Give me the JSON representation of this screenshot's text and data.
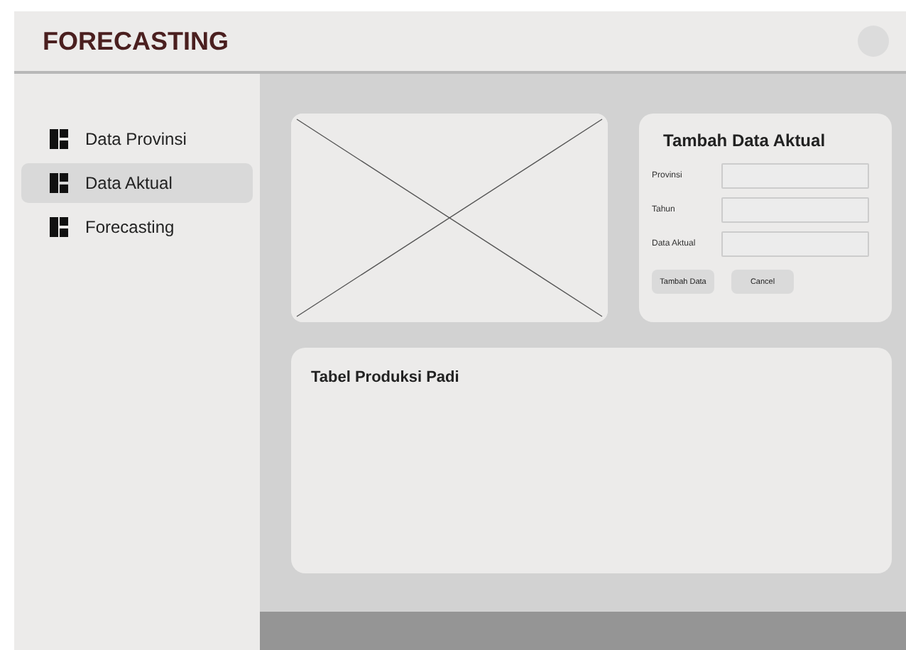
{
  "header": {
    "title": "FORECASTING"
  },
  "sidebar": {
    "items": [
      {
        "label": "Data Provinsi",
        "selected": false
      },
      {
        "label": "Data Aktual",
        "selected": true
      },
      {
        "label": "Forecasting",
        "selected": false
      }
    ]
  },
  "form": {
    "title": "Tambah Data Aktual",
    "fields": [
      {
        "label": "Provinsi"
      },
      {
        "label": "Tahun"
      },
      {
        "label": "Data Aktual"
      }
    ],
    "buttons": [
      "Tambah Data",
      "Cancel"
    ]
  },
  "table_card": {
    "title": "Tabel Produksi Padi"
  }
}
